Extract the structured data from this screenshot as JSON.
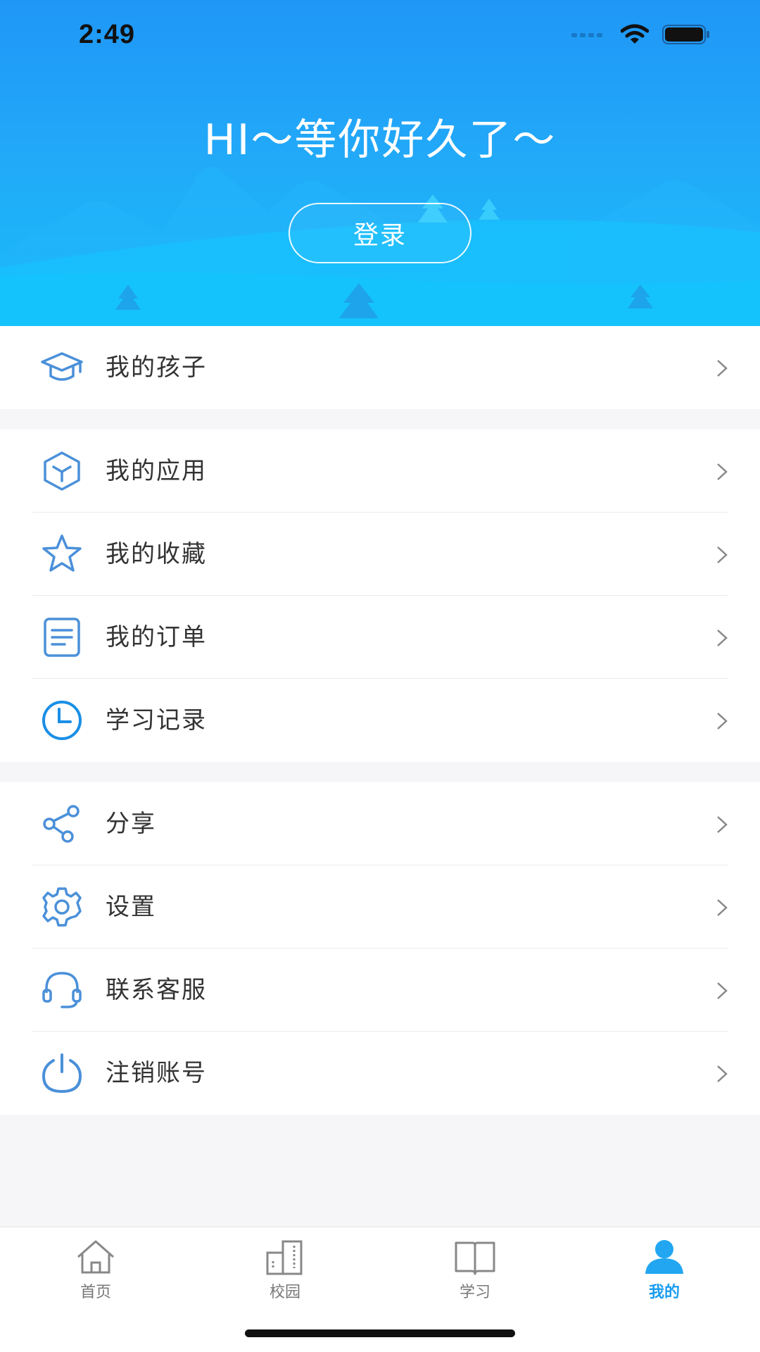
{
  "status_bar": {
    "time": "2:49"
  },
  "header": {
    "greeting": "HI～等你好久了～",
    "login_label": "登录"
  },
  "menu": {
    "section1": [
      {
        "label": "我的孩子",
        "icon": "graduation-cap-icon"
      }
    ],
    "section2": [
      {
        "label": "我的应用",
        "icon": "cube-icon"
      },
      {
        "label": "我的收藏",
        "icon": "star-icon"
      },
      {
        "label": "我的订单",
        "icon": "document-icon"
      },
      {
        "label": "学习记录",
        "icon": "clock-icon"
      }
    ],
    "section3": [
      {
        "label": "分享",
        "icon": "share-icon"
      },
      {
        "label": "设置",
        "icon": "gear-icon"
      },
      {
        "label": "联系客服",
        "icon": "headset-icon"
      },
      {
        "label": "注销账号",
        "icon": "power-icon"
      }
    ]
  },
  "tabbar": {
    "tabs": [
      {
        "label": "首页",
        "icon": "home-icon",
        "active": false
      },
      {
        "label": "校园",
        "icon": "campus-icon",
        "active": false
      },
      {
        "label": "学习",
        "icon": "book-icon",
        "active": false
      },
      {
        "label": "我的",
        "icon": "user-icon",
        "active": true
      }
    ]
  },
  "colors": {
    "accent": "#1a9cf0",
    "icon_blue": "#4a90d9",
    "header_top": "#1f97f7",
    "header_bottom": "#18bdfa"
  }
}
